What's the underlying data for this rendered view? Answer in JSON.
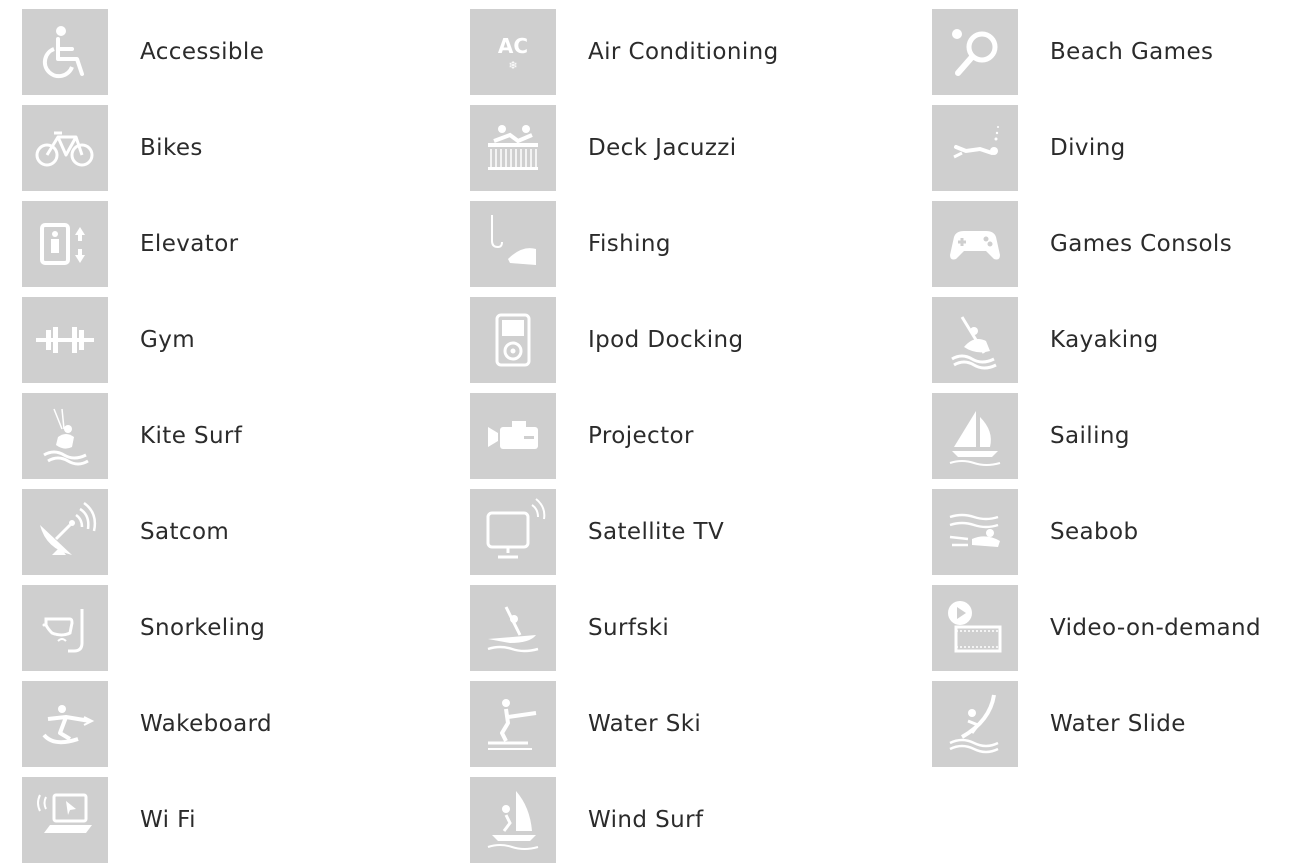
{
  "icon_color": "#ffffff",
  "tile_color": "#cfcfcf",
  "text_color": "#2b2b2b",
  "amenities": [
    {
      "label": "Accessible",
      "icon": "wheelchair-icon"
    },
    {
      "label": "Air Conditioning",
      "icon": "air-conditioning-icon",
      "icon_text": "AC"
    },
    {
      "label": "Beach Games",
      "icon": "paddle-ball-icon"
    },
    {
      "label": "Bikes",
      "icon": "bicycle-icon"
    },
    {
      "label": "Deck Jacuzzi",
      "icon": "jacuzzi-icon"
    },
    {
      "label": "Diving",
      "icon": "diver-icon"
    },
    {
      "label": "Elevator",
      "icon": "elevator-icon"
    },
    {
      "label": "Fishing",
      "icon": "fishing-icon"
    },
    {
      "label": "Games Consols",
      "icon": "gamepad-icon"
    },
    {
      "label": "Gym",
      "icon": "dumbbell-icon"
    },
    {
      "label": "Ipod Docking",
      "icon": "ipod-icon"
    },
    {
      "label": "Kayaking",
      "icon": "kayak-icon"
    },
    {
      "label": "Kite Surf",
      "icon": "kite-surf-icon"
    },
    {
      "label": "Projector",
      "icon": "projector-icon"
    },
    {
      "label": "Sailing",
      "icon": "sailboat-icon"
    },
    {
      "label": "Satcom",
      "icon": "satellite-dish-icon"
    },
    {
      "label": "Satellite TV",
      "icon": "satellite-tv-icon"
    },
    {
      "label": "Seabob",
      "icon": "seabob-icon"
    },
    {
      "label": "Snorkeling",
      "icon": "snorkel-mask-icon"
    },
    {
      "label": "Surfski",
      "icon": "surfski-icon"
    },
    {
      "label": "Video-on-demand",
      "icon": "video-on-demand-icon"
    },
    {
      "label": "Wakeboard",
      "icon": "wakeboard-icon"
    },
    {
      "label": "Water Ski",
      "icon": "water-ski-icon"
    },
    {
      "label": "Water Slide",
      "icon": "water-slide-icon"
    },
    {
      "label": "Wi Fi",
      "icon": "wifi-laptop-icon"
    },
    {
      "label": "Wind Surf",
      "icon": "windsurf-icon"
    }
  ]
}
